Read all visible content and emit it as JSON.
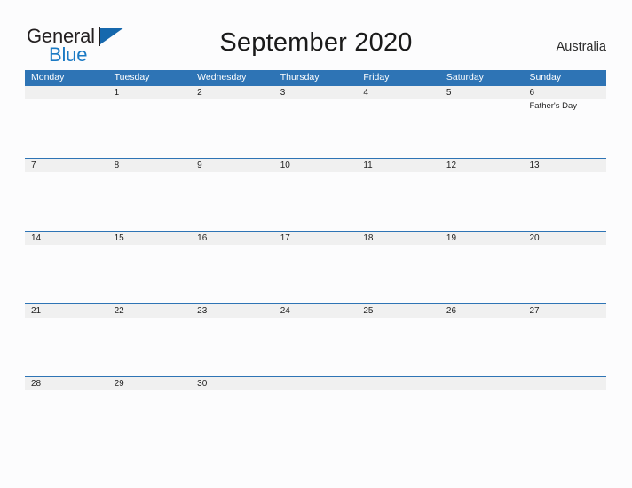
{
  "brand": {
    "name_part1": "General",
    "name_part2": "Blue",
    "flag_icon": "flag-icon",
    "color_primary": "#1668ad",
    "color_text": "#231f20"
  },
  "header": {
    "title": "September 2020",
    "region": "Australia"
  },
  "calendar": {
    "accent_color": "#2e74b5",
    "date_band_color": "#f0f0f0",
    "weekdays": [
      "Monday",
      "Tuesday",
      "Wednesday",
      "Thursday",
      "Friday",
      "Saturday",
      "Sunday"
    ],
    "weeks": [
      {
        "days": [
          {
            "date": "",
            "event": ""
          },
          {
            "date": "1",
            "event": ""
          },
          {
            "date": "2",
            "event": ""
          },
          {
            "date": "3",
            "event": ""
          },
          {
            "date": "4",
            "event": ""
          },
          {
            "date": "5",
            "event": ""
          },
          {
            "date": "6",
            "event": "Father's Day"
          }
        ]
      },
      {
        "days": [
          {
            "date": "7",
            "event": ""
          },
          {
            "date": "8",
            "event": ""
          },
          {
            "date": "9",
            "event": ""
          },
          {
            "date": "10",
            "event": ""
          },
          {
            "date": "11",
            "event": ""
          },
          {
            "date": "12",
            "event": ""
          },
          {
            "date": "13",
            "event": ""
          }
        ]
      },
      {
        "days": [
          {
            "date": "14",
            "event": ""
          },
          {
            "date": "15",
            "event": ""
          },
          {
            "date": "16",
            "event": ""
          },
          {
            "date": "17",
            "event": ""
          },
          {
            "date": "18",
            "event": ""
          },
          {
            "date": "19",
            "event": ""
          },
          {
            "date": "20",
            "event": ""
          }
        ]
      },
      {
        "days": [
          {
            "date": "21",
            "event": ""
          },
          {
            "date": "22",
            "event": ""
          },
          {
            "date": "23",
            "event": ""
          },
          {
            "date": "24",
            "event": ""
          },
          {
            "date": "25",
            "event": ""
          },
          {
            "date": "26",
            "event": ""
          },
          {
            "date": "27",
            "event": ""
          }
        ]
      },
      {
        "days": [
          {
            "date": "28",
            "event": ""
          },
          {
            "date": "29",
            "event": ""
          },
          {
            "date": "30",
            "event": ""
          },
          {
            "date": "",
            "event": ""
          },
          {
            "date": "",
            "event": ""
          },
          {
            "date": "",
            "event": ""
          },
          {
            "date": "",
            "event": ""
          }
        ]
      }
    ]
  }
}
